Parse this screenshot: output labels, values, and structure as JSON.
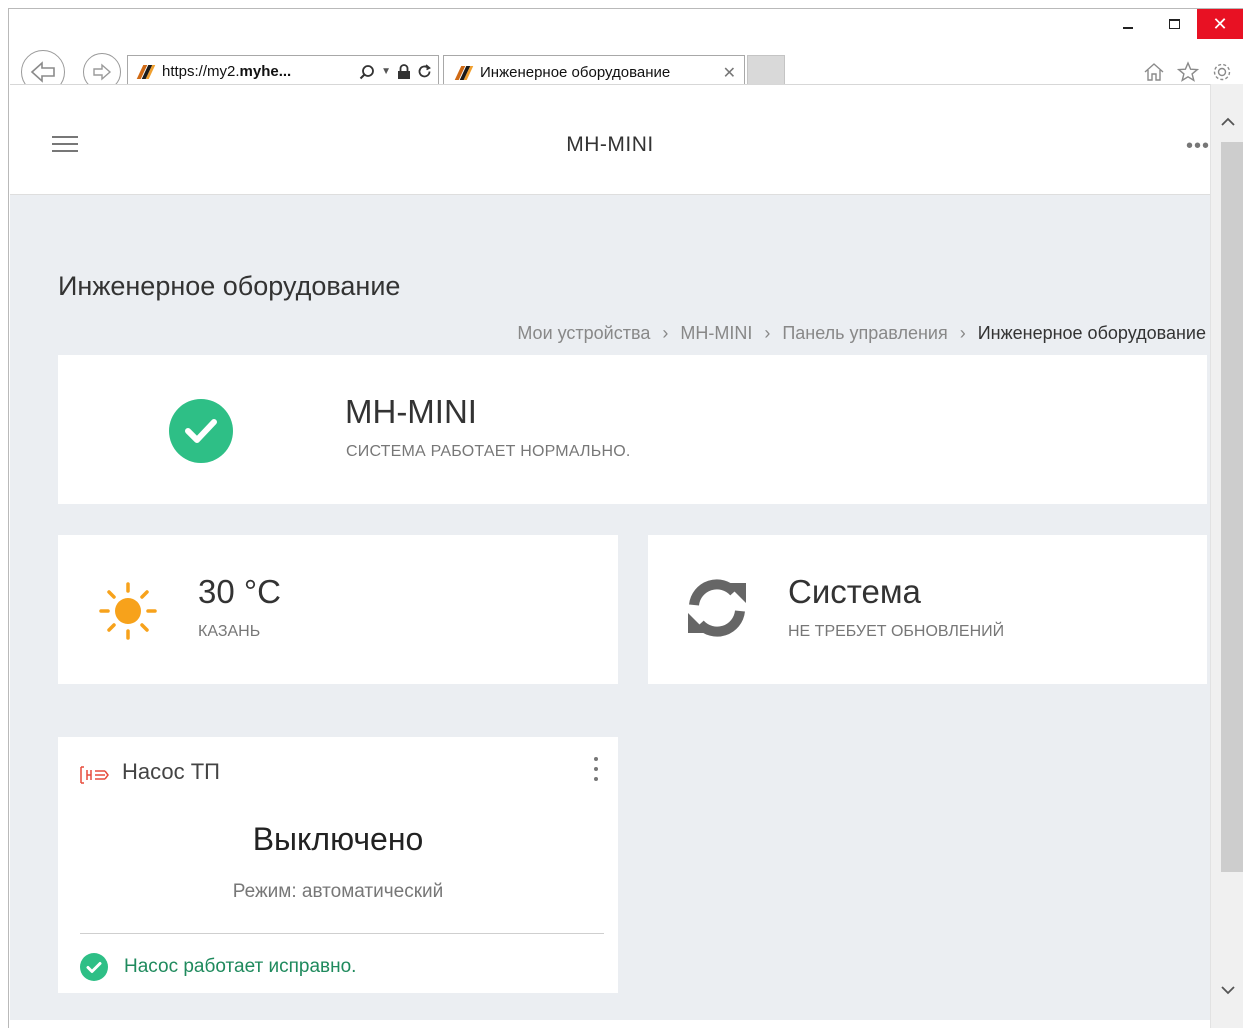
{
  "browser": {
    "url_prefix": "https://my2.",
    "url_bold": "myhe...",
    "tab_title": "Инженерное оборудование"
  },
  "app": {
    "title": "MH-MINI"
  },
  "page": {
    "title": "Инженерное оборудование",
    "breadcrumb": [
      "Мои устройства",
      "MH-MINI",
      "Панель управления",
      "Инженерное оборудование"
    ]
  },
  "status": {
    "name": "MH-MINI",
    "message": "СИСТЕМА РАБОТАЕТ НОРМАЛЬНО."
  },
  "weather": {
    "temperature": "30 °C",
    "city": "КАЗАНЬ"
  },
  "system": {
    "title": "Система",
    "message": "НЕ ТРЕБУЕТ ОБНОВЛЕНИЙ"
  },
  "pump": {
    "name": "Насос ТП",
    "state": "Выключено",
    "mode": "Режим: автоматический",
    "health": "Насос работает исправно."
  },
  "colors": {
    "ok_green": "#2ebf86",
    "sun_orange": "#f7a21b",
    "pump_icon_red": "#e74c3c",
    "page_bg": "#ebeef2",
    "close_red": "#e81123"
  },
  "icons": [
    "back-icon",
    "forward-icon",
    "search-icon",
    "lock-icon",
    "refresh-icon",
    "home-icon",
    "star-icon",
    "settings-icon",
    "hamburger-icon",
    "more-icon",
    "check-icon",
    "sun-icon",
    "sync-icon",
    "pump-icon",
    "kebab-icon"
  ]
}
